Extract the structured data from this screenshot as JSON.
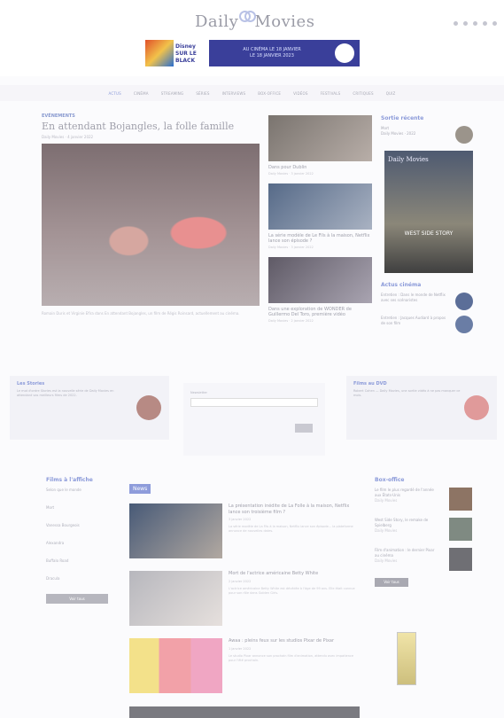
{
  "header": {
    "logo_left": "Daily",
    "logo_right": "Movies",
    "banner": {
      "brand": "Disney",
      "product": "SUR LE BLACK",
      "text": "AU CINÉMA LE 18 JANVIER",
      "sub": "LE 18 JANVIER 2023"
    },
    "social_icons": [
      "facebook-icon",
      "twitter-icon",
      "instagram-icon",
      "youtube-icon",
      "search-icon"
    ]
  },
  "nav": {
    "items": [
      "Actus",
      "Cinéma",
      "Streaming",
      "Séries",
      "Interviews",
      "Box-office",
      "Vidéos",
      "Festivals",
      "Critiques",
      "Quiz"
    ]
  },
  "featured": {
    "kicker": "Evénements",
    "title": "En attendant Bojangles, la folle famille",
    "meta": "Daily Movies · 4 janvier 2022",
    "caption": "Romain Duris et Virginie Efira dans En attendant Bojangles, un film de Régis Roinsard, actuellement au cinéma."
  },
  "cards": [
    {
      "title": "Dans pour Dublin",
      "meta": "Daily Movies · 3 janvier 2022"
    },
    {
      "title": "La série modèle de Le Fils à la maison, Netflix lance son épisode ?",
      "meta": "Daily Movies · 3 janvier 2022"
    },
    {
      "title": "Dans une exploration de WONDER de Guillermo Del Toro, première vidéo",
      "meta": "Daily Movies · 2 janvier 2022"
    }
  ],
  "right": {
    "trending_title": "Sortie récente",
    "trending": [
      {
        "title": "Mort",
        "meta": "Daily Movies · 2022"
      }
    ],
    "poster_title": "Daily Movies",
    "poster_sub": "WEST SIDE STORY",
    "recent_title": "Actus cinéma",
    "recent": [
      {
        "title": "Entretien : Dans le monde de Netflix avec ses scénaristes"
      },
      {
        "title": "Entretien : Jacques Audiard à propos de son film"
      }
    ]
  },
  "mid": {
    "left_title": "Les Stories",
    "left_text": "Le mot d'ordre Stories est la nouvelle série de Daily Movies en attendant vos meilleurs films de 2022.",
    "center_label": "Newsletter",
    "right_title": "Films au DVD",
    "right_text": "Robert Cohen — Daily Movies, une sortie vidéo à ne pas manquer ce mois."
  },
  "left_widget": {
    "title": "Films à l'affiche",
    "items": [
      "Selon que le monde",
      "Mort",
      "Vanessa Bourgeois",
      "Alexandra",
      "Buffalo Road",
      "Dracula"
    ],
    "button": "Voir tous"
  },
  "news": {
    "title": "News",
    "items": [
      {
        "title": "La présentation inédite de La Folle à la maison, Netflix lance son troisième film ?",
        "meta": "3 janvier 2022",
        "excerpt": "La série modèle de La Fils à la maison, Netflix lance son épisode... la plateforme annonce de nouvelles dates."
      },
      {
        "title": "Mort de l'actrice américaine Betty White",
        "meta": "2 janvier 2022",
        "excerpt": "L'actrice américaine Betty White est décédée à l'âge de 99 ans. Elle était connue pour son rôle dans Golden Girls."
      },
      {
        "title": "Awaa : pleins feux sur les studios Pixar de Pixar",
        "meta": "1 janvier 2022",
        "excerpt": "Le studio Pixar annonce son prochain film d'animation, attendu avec impatience pour l'été prochain."
      }
    ]
  },
  "side_widget": {
    "title": "Box-office",
    "items": [
      {
        "title": "Le film le plus regardé de l'année aux États-Unis",
        "meta": "Daily Movies"
      },
      {
        "title": "West Side Story, le remake de Spielberg",
        "meta": "Daily Movies"
      },
      {
        "title": "Film d'animation : le dernier Pixar au cinéma",
        "meta": "Daily Movies"
      }
    ],
    "button": "Voir tous"
  }
}
